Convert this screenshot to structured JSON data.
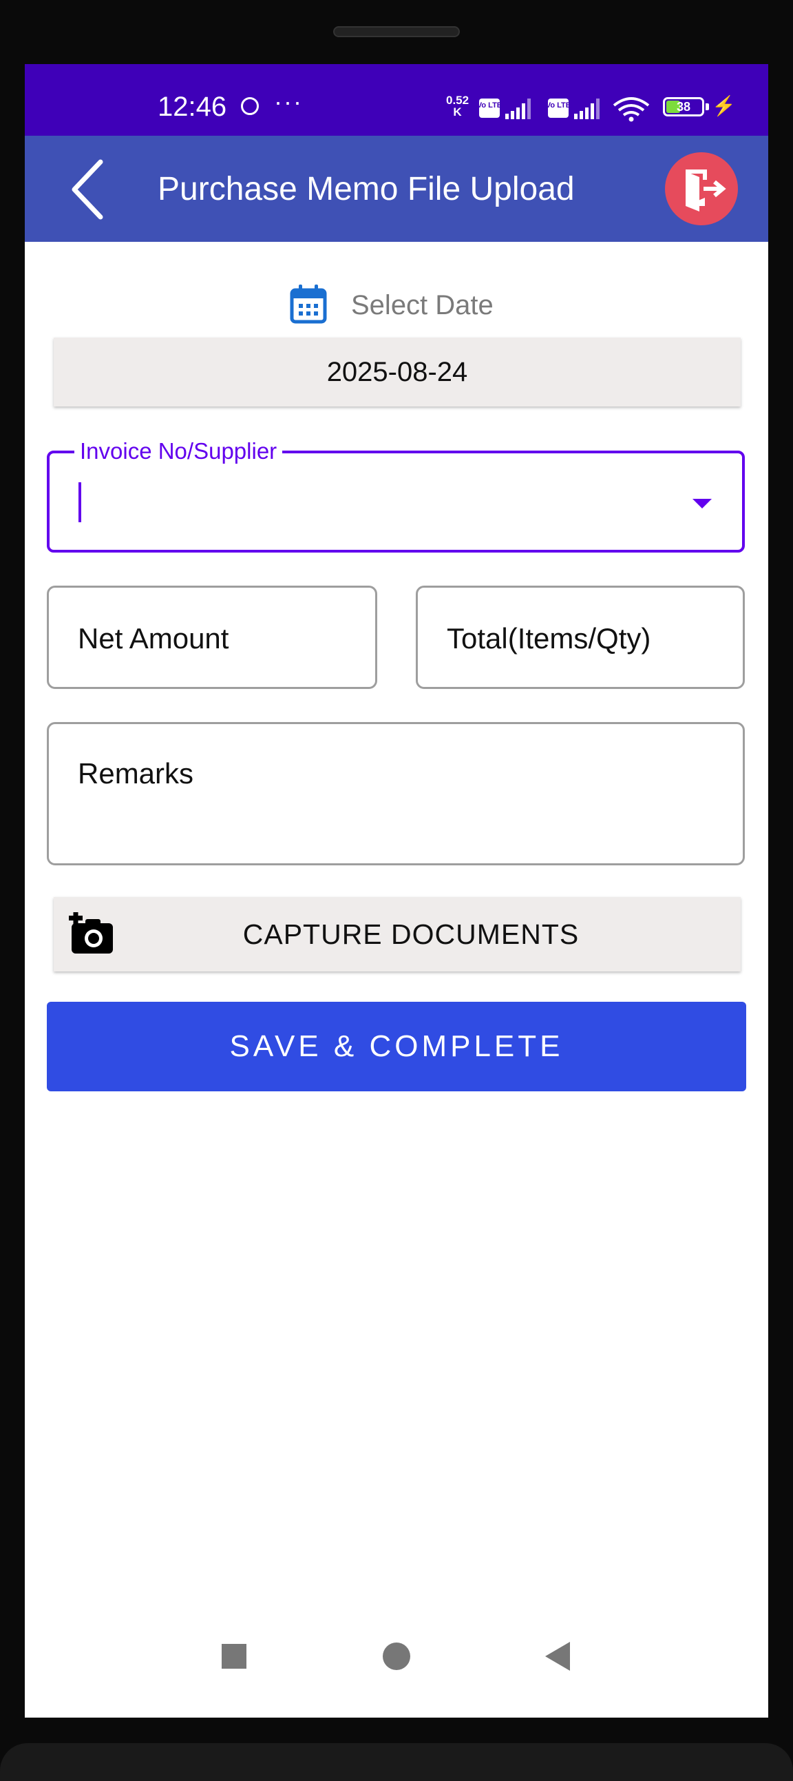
{
  "status_bar": {
    "time": "12:46",
    "more": "···",
    "net_speed_value": "0.52",
    "net_speed_unit": "K",
    "sim1": "Vo LTE",
    "sim2": "Vo LTE",
    "battery": "38",
    "icons": [
      "face-icon",
      "signal-icon",
      "wifi-icon",
      "battery-icon",
      "charging-icon"
    ]
  },
  "app_bar": {
    "title": "Purchase Memo File Upload",
    "background": "#3f51b5",
    "exit_color": "#e64b5c"
  },
  "date": {
    "label": "Select Date",
    "value": "2025-08-24"
  },
  "invoice_field": {
    "label": "Invoice No/Supplier",
    "value": "",
    "accent": "#6200ee"
  },
  "net_amount": {
    "placeholder": "Net Amount"
  },
  "total": {
    "placeholder": "Total(Items/Qty)"
  },
  "remarks": {
    "placeholder": "Remarks"
  },
  "capture": {
    "label": "CAPTURE DOCUMENTS"
  },
  "save": {
    "label": "SAVE & COMPLETE",
    "color": "#304ce3"
  }
}
